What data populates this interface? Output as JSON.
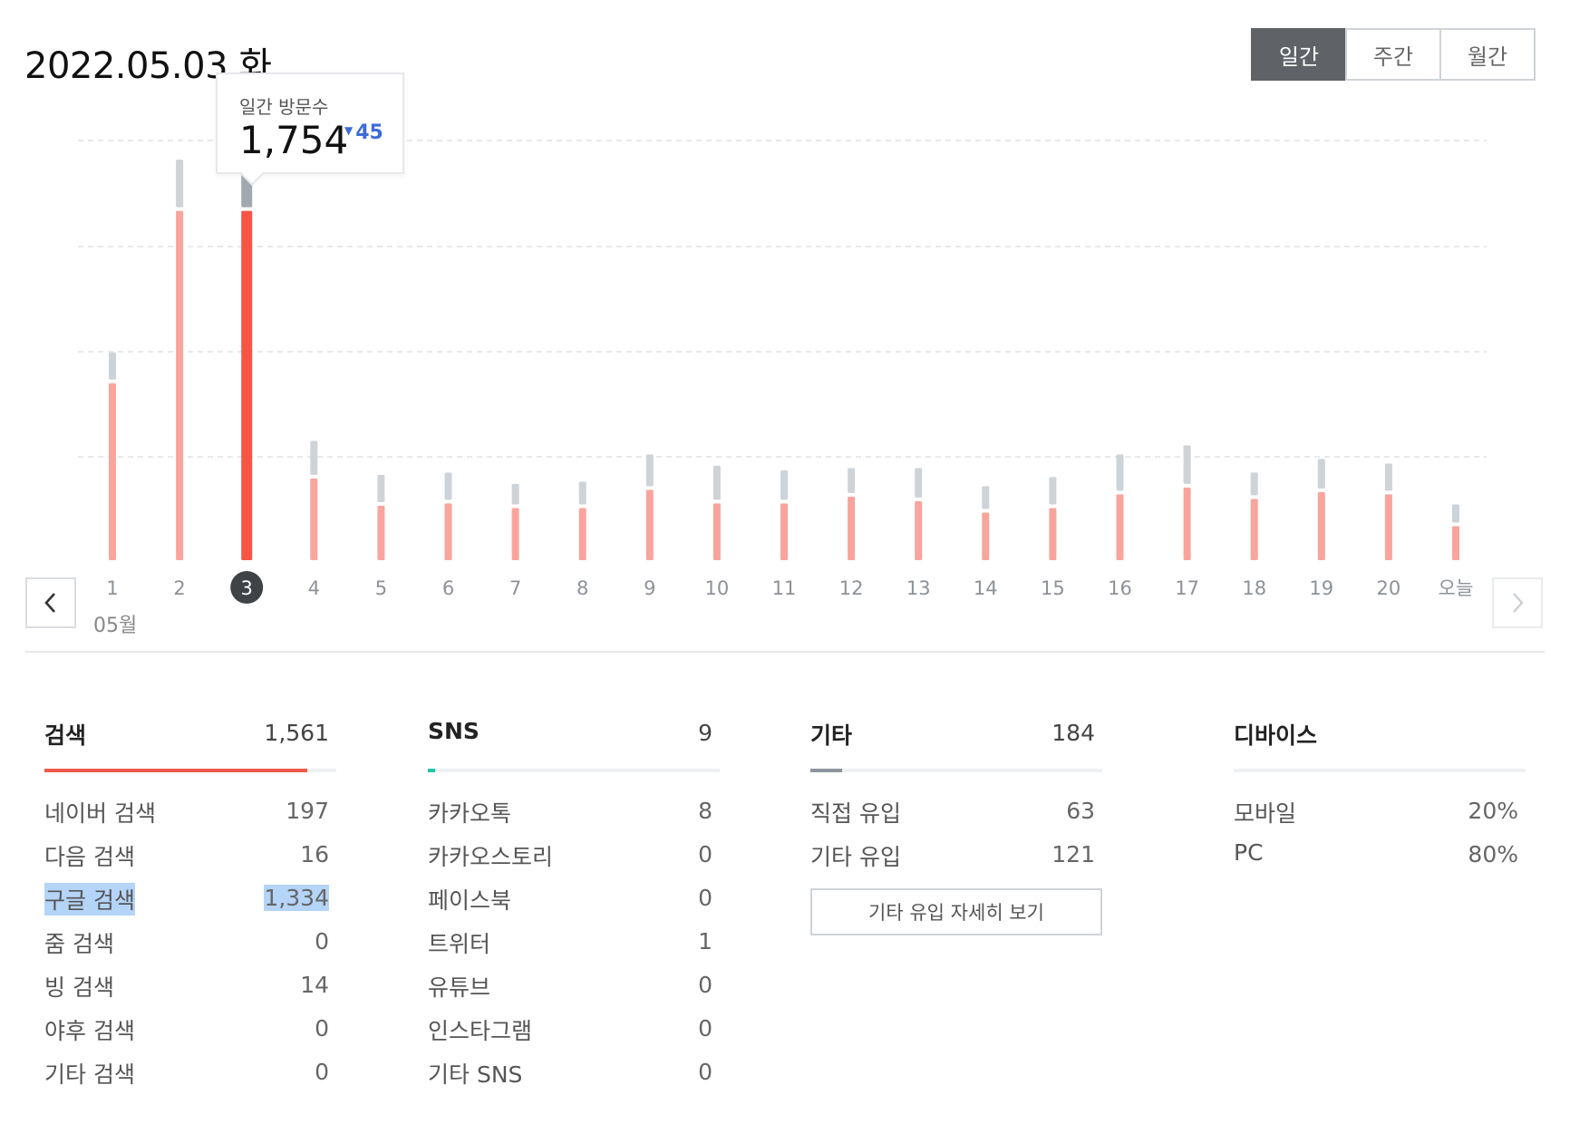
{
  "header": {
    "date": "2022.05.03 화"
  },
  "period_tabs": [
    {
      "label": "일간",
      "active": true
    },
    {
      "label": "주간",
      "active": false
    },
    {
      "label": "월간",
      "active": false
    }
  ],
  "tooltip": {
    "label": "일간 방문수",
    "value": "1,754",
    "change": "45"
  },
  "month_label": "05월",
  "chart_data": {
    "type": "bar",
    "categories": [
      "1",
      "2",
      "3",
      "4",
      "5",
      "6",
      "7",
      "8",
      "9",
      "10",
      "11",
      "12",
      "13",
      "14",
      "15",
      "16",
      "17",
      "18",
      "19",
      "20",
      "오늘"
    ],
    "selected_index": 2,
    "series": [
      {
        "values": [
          780,
          1540,
          1540,
          360,
          240,
          250,
          230,
          230,
          310,
          250,
          250,
          280,
          260,
          210,
          230,
          290,
          320,
          270,
          300,
          290,
          150
        ]
      },
      {
        "values": [
          120,
          210,
          170,
          150,
          120,
          120,
          90,
          100,
          140,
          150,
          130,
          110,
          130,
          100,
          120,
          160,
          170,
          100,
          130,
          120,
          80
        ]
      }
    ],
    "colors": {
      "primary": "#f9a49c",
      "primary_selected": "#f65445",
      "secondary": "#ced3d8",
      "secondary_selected": "#a2a8af"
    },
    "grid": true
  },
  "sections": {
    "search": {
      "title": "검색",
      "total": "1,561",
      "bar_fraction": 0.9,
      "bar_color": "#f05a4a",
      "rows": [
        {
          "label": "네이버 검색",
          "value": "197"
        },
        {
          "label": "다음 검색",
          "value": "16"
        },
        {
          "label": "구글 검색",
          "value": "1,334"
        },
        {
          "label": "줌 검색",
          "value": "0"
        },
        {
          "label": "빙 검색",
          "value": "14"
        },
        {
          "label": "야후 검색",
          "value": "0"
        },
        {
          "label": "기타 검색",
          "value": "0"
        }
      ]
    },
    "sns": {
      "title": "SNS",
      "total": "9",
      "bar_fraction": 0.025,
      "bar_color": "#1ec8a5",
      "rows": [
        {
          "label": "카카오톡",
          "value": "8"
        },
        {
          "label": "카카오스토리",
          "value": "0"
        },
        {
          "label": "페이스북",
          "value": "0"
        },
        {
          "label": "트위터",
          "value": "1"
        },
        {
          "label": "유튜브",
          "value": "0"
        },
        {
          "label": "인스타그램",
          "value": "0"
        },
        {
          "label": "기타 SNS",
          "value": "0"
        }
      ]
    },
    "etc": {
      "title": "기타",
      "total": "184",
      "bar_fraction": 0.11,
      "bar_color": "#8e959d",
      "rows": [
        {
          "label": "직접 유입",
          "value": "63"
        },
        {
          "label": "기타 유입",
          "value": "121"
        }
      ],
      "detail_button": "기타 유입 자세히 보기"
    },
    "device": {
      "title": "디바이스",
      "rows": [
        {
          "label": "모바일",
          "value": "20%"
        },
        {
          "label": "PC",
          "value": "80%"
        }
      ]
    }
  }
}
